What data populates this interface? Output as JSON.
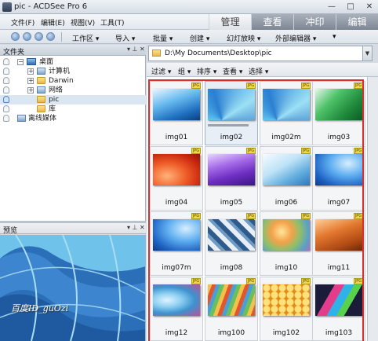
{
  "window": {
    "title": "pic - ACDSee Pro 6"
  },
  "menu": {
    "items": [
      "文件(F)",
      "编辑(E)",
      "视图(V)",
      "工具(T)"
    ]
  },
  "mode_tabs": {
    "manage": "管理",
    "view": "查看",
    "develop": "冲印",
    "edit": "编辑"
  },
  "toolbar": {
    "workspace": "工作区",
    "import": "导入",
    "batch": "批量",
    "create": "创建",
    "slideshow": "幻灯放映",
    "external_editor": "外部编辑器"
  },
  "folders_panel": {
    "title": "文件夹",
    "tree": {
      "desktop": "桌面",
      "computer": "计算机",
      "darwin": "Darwin",
      "network": "网络",
      "pic": "pic",
      "library": "库",
      "offline_media": "离线媒体"
    }
  },
  "preview_panel": {
    "title": "预览",
    "watermark": "百度ID_guOzi"
  },
  "path": {
    "value": "D:\\My Documents\\Desktop\\pic"
  },
  "filterbar": {
    "filter": "过滤",
    "group": "组",
    "sort": "排序",
    "view": "查看",
    "select": "选择"
  },
  "thumbnails": [
    {
      "name": "img01"
    },
    {
      "name": "img02"
    },
    {
      "name": "img02m"
    },
    {
      "name": "img03"
    },
    {
      "name": "img04"
    },
    {
      "name": "img05"
    },
    {
      "name": "img06"
    },
    {
      "name": "img07"
    },
    {
      "name": "img07m"
    },
    {
      "name": "img08"
    },
    {
      "name": "img10"
    },
    {
      "name": "img11"
    },
    {
      "name": "img12"
    },
    {
      "name": "img100"
    },
    {
      "name": "img102"
    },
    {
      "name": "img103"
    }
  ],
  "colors": {
    "selection_border": "#d82f2f",
    "title_bg": "#e3e8ef"
  }
}
